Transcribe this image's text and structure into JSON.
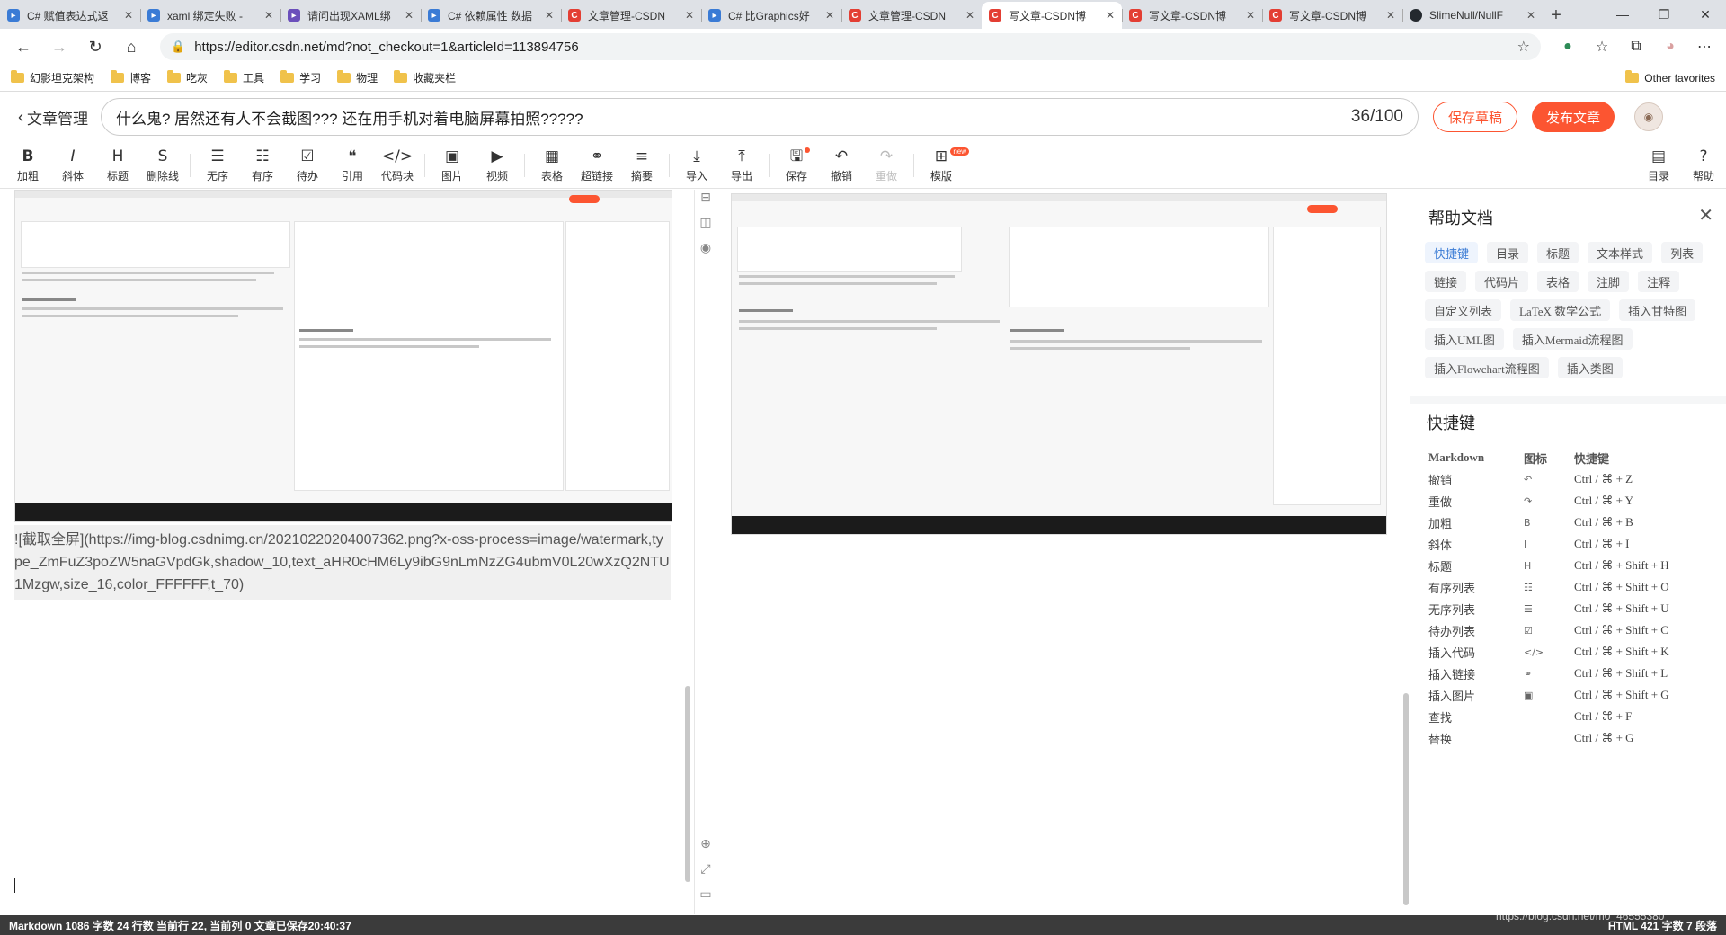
{
  "browser": {
    "tabs": [
      {
        "label": "C# 赋值表达式返",
        "icon": "blue"
      },
      {
        "label": "xaml 绑定失败 -",
        "icon": "blue"
      },
      {
        "label": "请问出现XAML绑",
        "icon": "purple"
      },
      {
        "label": "C# 依赖属性 数据",
        "icon": "blue"
      },
      {
        "label": "文章管理-CSDN",
        "icon": "red"
      },
      {
        "label": "C# 比Graphics好",
        "icon": "blue"
      },
      {
        "label": "文章管理-CSDN",
        "icon": "red"
      },
      {
        "label": "写文章-CSDN博",
        "icon": "red",
        "active": true
      },
      {
        "label": "写文章-CSDN博",
        "icon": "red"
      },
      {
        "label": "写文章-CSDN博",
        "icon": "red"
      },
      {
        "label": "SlimeNull/NullF",
        "icon": "gh"
      }
    ],
    "url": "https://editor.csdn.net/md?not_checkout=1&articleId=113894756",
    "bookmarks": [
      "幻影坦克架构",
      "博客",
      "吃灰",
      "工具",
      "学习",
      "物理",
      "收藏夹栏"
    ],
    "other_favorites": "Other favorites"
  },
  "header": {
    "back_label": "文章管理",
    "title": "什么鬼? 居然还有人不会截图??? 还在用手机对着电脑屏幕拍照?????",
    "title_count": "36/100",
    "save_draft": "保存草稿",
    "publish": "发布文章"
  },
  "toolbar": {
    "items": [
      {
        "icon": "B",
        "label": "加粗"
      },
      {
        "icon": "I",
        "label": "斜体"
      },
      {
        "icon": "H",
        "label": "标题"
      },
      {
        "icon": "S",
        "label": "删除线"
      },
      {
        "icon": "☰",
        "label": "无序"
      },
      {
        "icon": "☷",
        "label": "有序"
      },
      {
        "icon": "☑",
        "label": "待办"
      },
      {
        "icon": "❝",
        "label": "引用"
      },
      {
        "icon": "</>",
        "label": "代码块"
      },
      {
        "icon": "▣",
        "label": "图片"
      },
      {
        "icon": "▶",
        "label": "视频"
      },
      {
        "icon": "▦",
        "label": "表格"
      },
      {
        "icon": "⚭",
        "label": "超链接"
      },
      {
        "icon": "≡",
        "label": "摘要"
      },
      {
        "icon": "⤓",
        "label": "导入"
      },
      {
        "icon": "⤒",
        "label": "导出"
      },
      {
        "icon": "🖫",
        "label": "保存"
      },
      {
        "icon": "↶",
        "label": "撤销"
      },
      {
        "icon": "↷",
        "label": "重做"
      },
      {
        "icon": "⊞",
        "label": "模版"
      }
    ],
    "new_badge": "new",
    "right_items": [
      {
        "icon": "▤",
        "label": "目录"
      },
      {
        "icon": "?",
        "label": "帮助"
      }
    ]
  },
  "editor": {
    "markdown_text": "![截取全屏](https://img-blog.csdnimg.cn/20210220204007362.png?x-oss-process=image/watermark,type_ZmFuZ3poZW5naGVpdGk,shadow_10,text_aHR0cHM6Ly9ibG9nLmNzZG4ubmV0L20wXzQ2NTU1Mzgw,size_16,color_FFFFFF,t_70)"
  },
  "help": {
    "title": "帮助文档",
    "chips": [
      "快捷键",
      "目录",
      "标题",
      "文本样式",
      "列表",
      "链接",
      "代码片",
      "表格",
      "注脚",
      "注释",
      "自定义列表",
      "LaTeX 数学公式",
      "插入甘特图",
      "插入UML图",
      "插入Mermaid流程图",
      "插入Flowchart流程图",
      "插入类图"
    ],
    "section": "快捷键",
    "columns": [
      "Markdown",
      "图标",
      "快捷键"
    ],
    "rows": [
      {
        "name": "撤销",
        "icon": "↶",
        "key": "Ctrl / ⌘ + Z"
      },
      {
        "name": "重做",
        "icon": "↷",
        "key": "Ctrl / ⌘ + Y"
      },
      {
        "name": "加粗",
        "icon": "B",
        "key": "Ctrl / ⌘ + B"
      },
      {
        "name": "斜体",
        "icon": "I",
        "key": "Ctrl / ⌘ + I"
      },
      {
        "name": "标题",
        "icon": "H",
        "key": "Ctrl / ⌘ + Shift + H"
      },
      {
        "name": "有序列表",
        "icon": "☷",
        "key": "Ctrl / ⌘ + Shift + O"
      },
      {
        "name": "无序列表",
        "icon": "☰",
        "key": "Ctrl / ⌘ + Shift + U"
      },
      {
        "name": "待办列表",
        "icon": "☑",
        "key": "Ctrl / ⌘ + Shift + C"
      },
      {
        "name": "插入代码",
        "icon": "</>",
        "key": "Ctrl / ⌘ + Shift + K"
      },
      {
        "name": "插入链接",
        "icon": "⚭",
        "key": "Ctrl / ⌘ + Shift + L"
      },
      {
        "name": "插入图片",
        "icon": "▣",
        "key": "Ctrl / ⌘ + Shift + G"
      },
      {
        "name": "查找",
        "icon": "",
        "key": "Ctrl / ⌘ + F"
      },
      {
        "name": "替换",
        "icon": "",
        "key": "Ctrl / ⌘ + G"
      }
    ]
  },
  "status": {
    "left": "Markdown  1086 字数  24 行数  当前行 22, 当前列 0  文章已保存20:40:37",
    "right": "HTML  421 字数  7 段落",
    "watermark": "https://blog.csdn.net/m0_46555380"
  },
  "colors": {
    "accent": "#fc5531",
    "link": "#3a7bd5"
  }
}
